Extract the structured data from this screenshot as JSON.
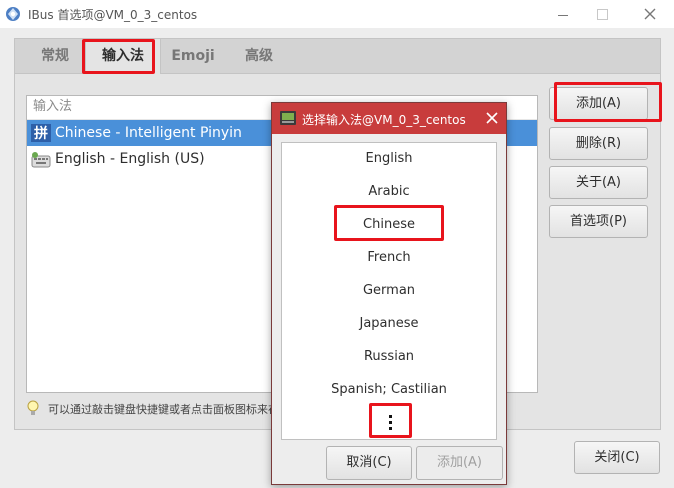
{
  "window": {
    "title": "IBus 首选项@VM_0_3_centos"
  },
  "tabs": [
    {
      "label": "常规"
    },
    {
      "label": "输入法"
    },
    {
      "label": "Emoji"
    },
    {
      "label": "高级"
    }
  ],
  "input_methods": {
    "header": "输入法",
    "items": [
      {
        "label": "Chinese - Intelligent Pinyin",
        "selected": true,
        "icon": "pinyin-icon"
      },
      {
        "label": "English - English (US)",
        "selected": false,
        "icon": "keyboard-icon"
      }
    ]
  },
  "hint": {
    "text": "可以通过敲击键盘快捷键或者点击面板图标来在选定的输入法中切换",
    "icon": "lightbulb-icon"
  },
  "side_buttons": {
    "add": "添加(A)",
    "remove": "删除(R)",
    "about": "关于(A)",
    "prefs": "首选项(P)"
  },
  "close_button": "关闭(C)",
  "dialog": {
    "title": "选择输入法@VM_0_3_centos",
    "languages": [
      "English",
      "Arabic",
      "Chinese",
      "French",
      "German",
      "Japanese",
      "Russian",
      "Spanish; Castilian"
    ],
    "more_icon": "more-vertical-icon",
    "cancel": "取消(C)",
    "add": "添加(A)"
  },
  "colors": {
    "selection": "#4a90d9",
    "dialog_titlebar": "#c83c3c",
    "annotation": "#e8141c"
  }
}
